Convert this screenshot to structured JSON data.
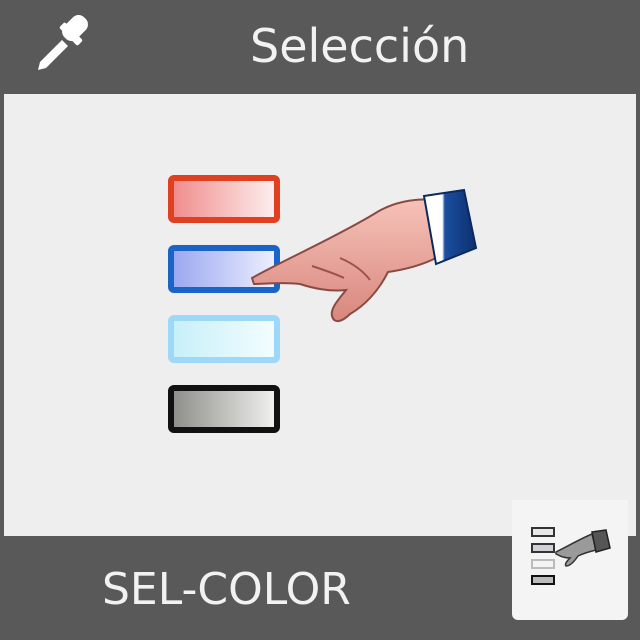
{
  "tile": {
    "title": "Selección",
    "label": "SEL-COLOR",
    "icons": {
      "header": "eyedropper-icon",
      "main": "color-selection-pointing-hand-icon",
      "badge": "color-selection-mini-icon"
    }
  },
  "colors": {
    "chrome": "#595959",
    "canvas": "#eeeeee",
    "text": "#f2f2f2",
    "swatch_red": "#e04020",
    "swatch_blue": "#1a64c8",
    "swatch_cyan": "#9ed8f8",
    "swatch_black": "#111111",
    "cuff_blue": "#1a4fa0"
  }
}
